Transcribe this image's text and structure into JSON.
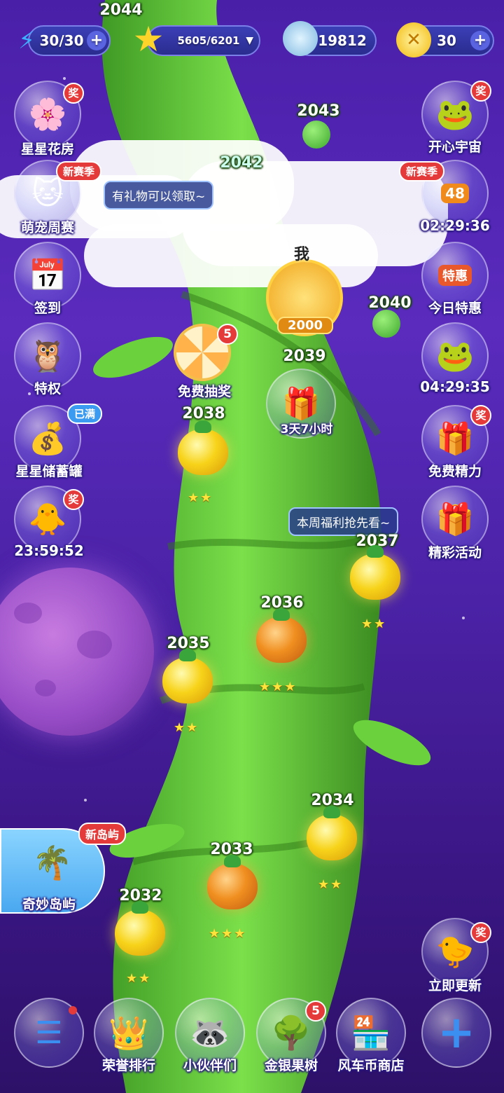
{
  "resources": {
    "energy": "30/30",
    "stars": "5605/6201",
    "coins": "19812",
    "windmill": "30"
  },
  "left_menu": [
    {
      "label": "星星花房",
      "badge": "奖"
    },
    {
      "label": "萌宠周赛",
      "badge": "新赛季"
    },
    {
      "label": "签到"
    },
    {
      "label": "特权"
    },
    {
      "label": "星星储蓄罐",
      "badge": "已满"
    },
    {
      "label": "23:59:52",
      "badge": "奖"
    }
  ],
  "right_menu": [
    {
      "label": "开心宇宙",
      "badge": "奖"
    },
    {
      "label": "02:29:36",
      "badge": "新赛季",
      "level": "48"
    },
    {
      "label": "今日特惠",
      "tag": "特惠"
    },
    {
      "label": "04:29:35"
    },
    {
      "label": "免费精力",
      "badge": "奖"
    },
    {
      "label": "精彩活动"
    }
  ],
  "tooltips": {
    "gift": "有礼物可以领取~",
    "weekly": "本周福利抢先看~"
  },
  "player": {
    "label": "我",
    "level": "2000"
  },
  "lottery": {
    "label": "免费抽奖",
    "count": "5"
  },
  "gift_box": {
    "timer": "3天7小时"
  },
  "levels": [
    {
      "num": "2044"
    },
    {
      "num": "2043"
    },
    {
      "num": "2042"
    },
    {
      "num": "2040"
    },
    {
      "num": "2039"
    },
    {
      "num": "2038",
      "stars": "★★"
    },
    {
      "num": "2037",
      "stars": "★★"
    },
    {
      "num": "2036",
      "stars": "★★★"
    },
    {
      "num": "2035",
      "stars": "★★"
    },
    {
      "num": "2034",
      "stars": "★★"
    },
    {
      "num": "2033",
      "stars": "★★★"
    },
    {
      "num": "2032",
      "stars": "★★"
    }
  ],
  "island": {
    "label": "奇妙岛屿",
    "badge": "新岛屿"
  },
  "update": {
    "label": "立即更新",
    "badge": "奖"
  },
  "bottom_bar": [
    {
      "label": ""
    },
    {
      "label": "荣誉排行"
    },
    {
      "label": "小伙伴们"
    },
    {
      "label": "金银果树",
      "badge": "5"
    },
    {
      "label": "风车币商店"
    }
  ],
  "colors": {
    "background": "#4a1fa8",
    "stalk": "#5fc23a",
    "badge": "#e53a3a"
  }
}
